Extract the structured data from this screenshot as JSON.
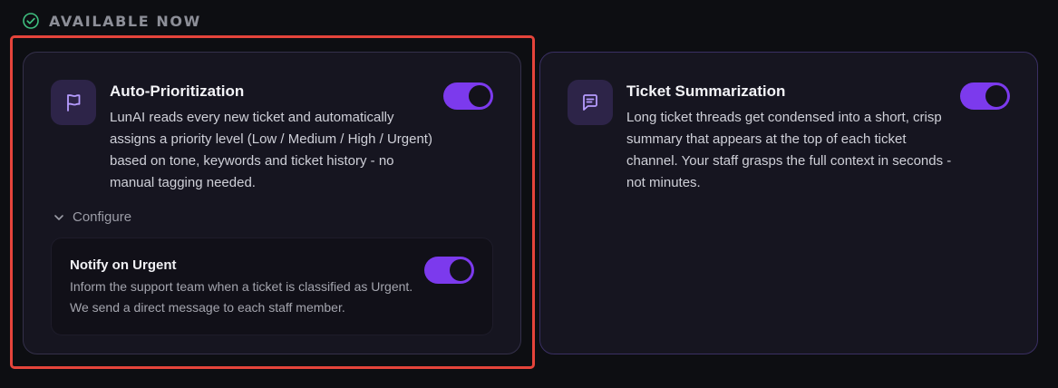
{
  "section": {
    "title": "AVAILABLE NOW",
    "icon": "check-circle-icon",
    "accent": "#3fbf7f"
  },
  "features": [
    {
      "title": "Auto-Prioritization",
      "icon": "flag-icon",
      "description": "LunAI reads every new ticket and automatically assigns a priority level (Low / Medium / High / Urgent) based on tone, keywords and ticket history - no manual tagging needed.",
      "enabled": true,
      "configure_label": "Configure",
      "options": [
        {
          "title": "Notify on Urgent",
          "description": "Inform the support team when a ticket is classified as Urgent. We send a direct message to each staff member.",
          "enabled": true
        }
      ]
    },
    {
      "title": "Ticket Summarization",
      "icon": "message-square-icon",
      "description": "Long ticket threads get condensed into a short, crisp summary that appears at the top of each ticket channel. Your staff grasps the full context in seconds - not minutes.",
      "enabled": true
    }
  ],
  "colors": {
    "toggle_on": "#7c3aed",
    "highlight_border": "#e5443b",
    "icon_stroke": "#b69cff"
  }
}
